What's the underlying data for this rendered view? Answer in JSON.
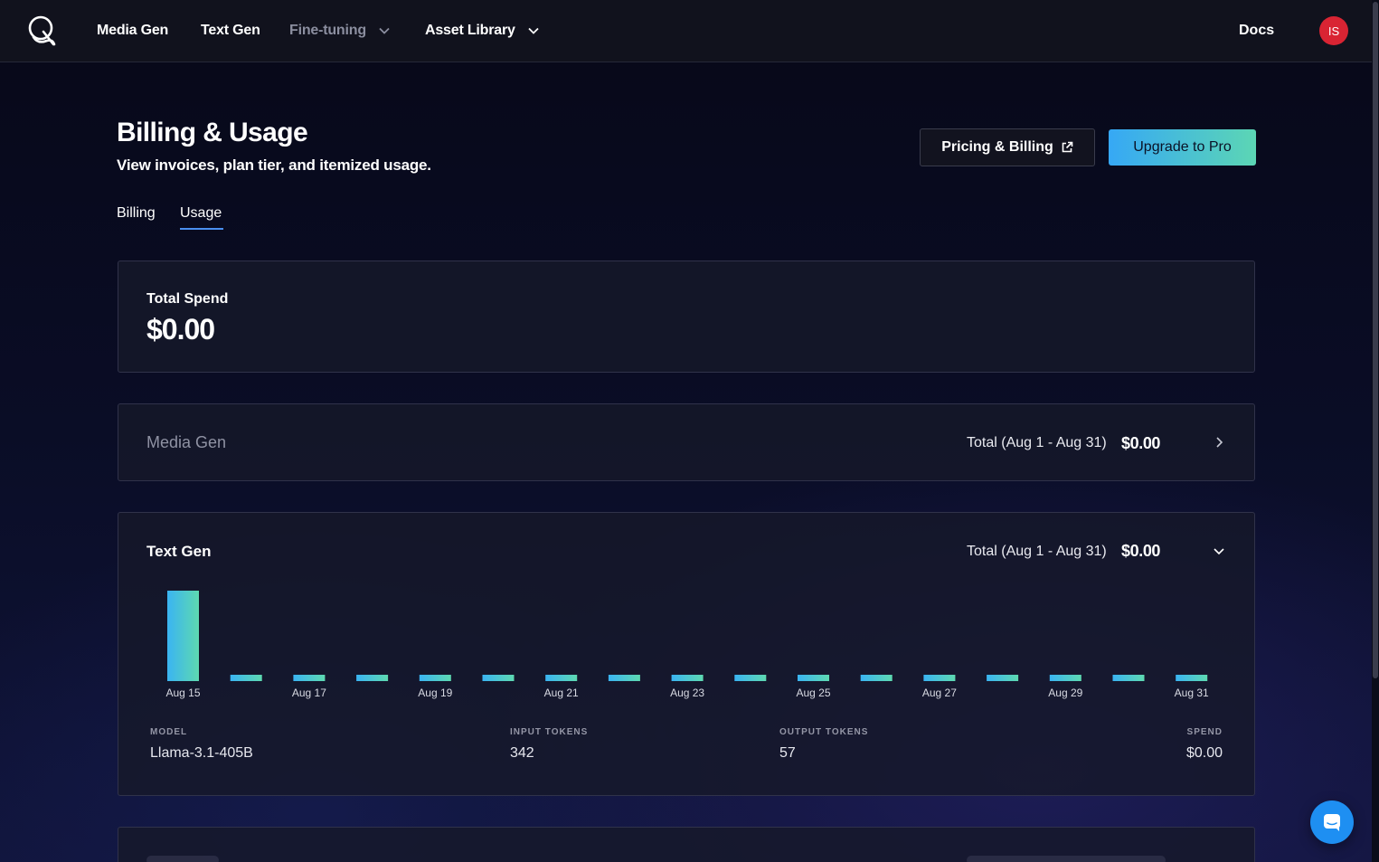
{
  "nav": {
    "items": [
      {
        "label": "Media Gen",
        "muted": false,
        "dropdown": false
      },
      {
        "label": "Text Gen",
        "muted": false,
        "dropdown": false
      },
      {
        "label": "Fine-tuning",
        "muted": true,
        "dropdown": true
      },
      {
        "label": "Asset Library",
        "muted": false,
        "dropdown": true
      }
    ],
    "docs_label": "Docs",
    "avatar_initials": "IS",
    "avatar_color": "#d92433"
  },
  "header": {
    "title": "Billing & Usage",
    "subtitle": "View invoices, plan tier, and itemized usage.",
    "pricing_button": "Pricing & Billing",
    "upgrade_button": "Upgrade to Pro"
  },
  "tabs": [
    {
      "label": "Billing",
      "active": false
    },
    {
      "label": "Usage",
      "active": true
    }
  ],
  "total_spend": {
    "label": "Total Spend",
    "value": "$0.00"
  },
  "media_gen": {
    "title": "Media Gen",
    "total_label": "Total (Aug 1 - Aug 31)",
    "total_value": "$0.00"
  },
  "text_gen": {
    "title": "Text Gen",
    "total_label": "Total (Aug 1 - Aug 31)",
    "total_value": "$0.00",
    "table": {
      "headers": {
        "model": "MODEL",
        "input": "INPUT TOKENS",
        "output": "OUTPUT TOKENS",
        "spend": "SPEND"
      },
      "row": {
        "model": "Llama-3.1-405B",
        "input": "342",
        "output": "57",
        "spend": "$0.00"
      }
    }
  },
  "chart_data": {
    "type": "bar",
    "categories": [
      "Aug 15",
      "Aug 16",
      "Aug 17",
      "Aug 18",
      "Aug 19",
      "Aug 20",
      "Aug 21",
      "Aug 22",
      "Aug 23",
      "Aug 24",
      "Aug 25",
      "Aug 26",
      "Aug 27",
      "Aug 28",
      "Aug 29",
      "Aug 30",
      "Aug 31"
    ],
    "tick_labels": [
      "Aug 15",
      "",
      "Aug 17",
      "",
      "Aug 19",
      "",
      "Aug 21",
      "",
      "Aug 23",
      "",
      "Aug 25",
      "",
      "Aug 27",
      "",
      "Aug 29",
      "",
      "Aug 31"
    ],
    "values": [
      399,
      0,
      0,
      0,
      0,
      0,
      0,
      0,
      0,
      0,
      0,
      0,
      0,
      0,
      0,
      0,
      0
    ],
    "grid": false,
    "bar_gradient": [
      "#3ab4f2",
      "#5ed9b0"
    ]
  },
  "colors": {
    "accent_blue": "#4a8ff0",
    "upgrade_gradient_start": "#36a8f5",
    "upgrade_gradient_end": "#5cd6b4",
    "chat_bubble": "#1e8ff2"
  },
  "icons": {
    "logo": "brand-logo-icon",
    "external": "external-link-icon",
    "chat": "chat-bubble-icon"
  }
}
